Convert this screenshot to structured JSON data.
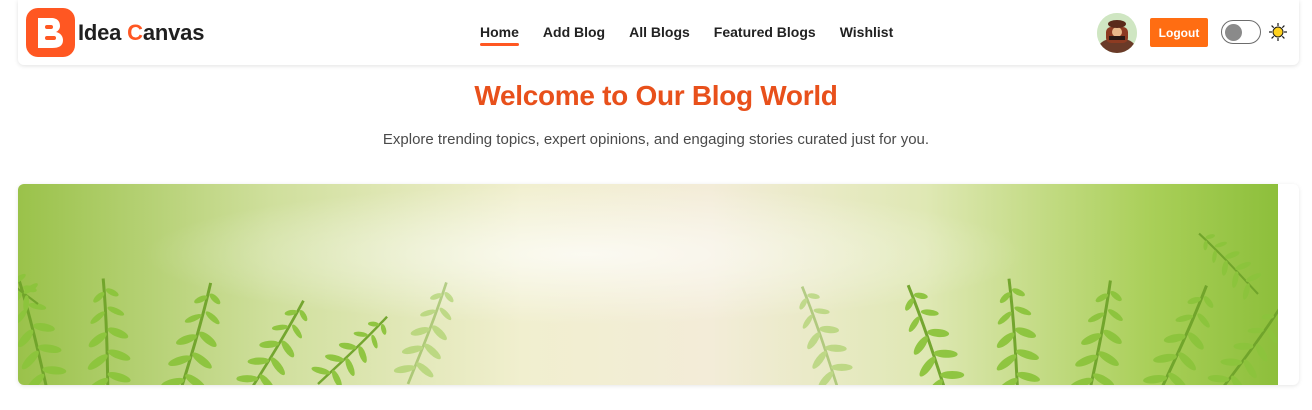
{
  "brand": {
    "logo_icon": "blogger-b-icon",
    "name_prefix": "Idea ",
    "name_accent": "C",
    "name_suffix": "anvas",
    "accent_color": "#ff5722"
  },
  "nav": {
    "items": [
      {
        "label": "Home",
        "active": true
      },
      {
        "label": "Add Blog",
        "active": false
      },
      {
        "label": "All Blogs",
        "active": false
      },
      {
        "label": "Featured Blogs",
        "active": false
      },
      {
        "label": "Wishlist",
        "active": false
      }
    ]
  },
  "user": {
    "avatar_icon": "user-avatar",
    "logout_label": "Logout",
    "logout_color": "#ff6d12"
  },
  "theme_toggle": {
    "state": "off",
    "icon": "sun-icon"
  },
  "hero": {
    "title": "Welcome to Our Blog World",
    "subtitle": "Explore trending topics, expert opinions, and engaging stories curated just for you.",
    "title_color": "#e8501b"
  },
  "banner": {
    "image": "fern-leaves-banner"
  }
}
